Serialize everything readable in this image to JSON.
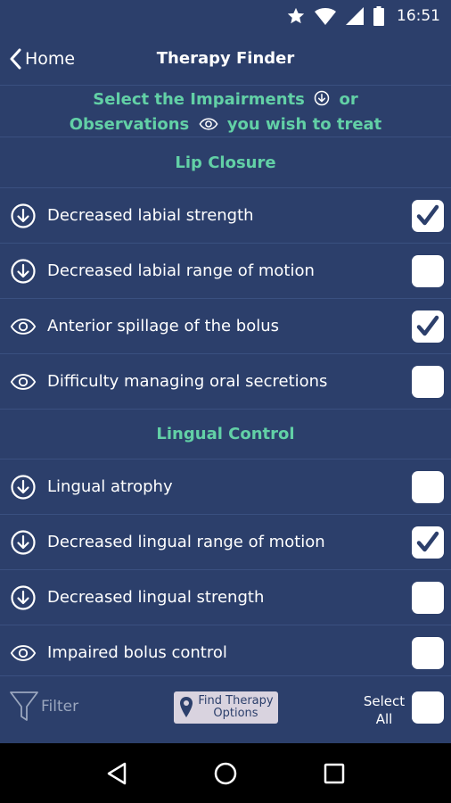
{
  "status": {
    "time": "16:51"
  },
  "header": {
    "back_label": "Home",
    "title": "Therapy Finder"
  },
  "instruction": {
    "line1_a": "Select the Impairments",
    "line1_b": "or",
    "line2_a": "Observations",
    "line2_b": "you wish to treat"
  },
  "sections": [
    {
      "title": "Lip Closure",
      "items": [
        {
          "type": "impairment",
          "label": "Decreased labial strength",
          "checked": true
        },
        {
          "type": "impairment",
          "label": "Decreased labial range of motion",
          "checked": false
        },
        {
          "type": "observation",
          "label": "Anterior spillage of the bolus",
          "checked": true
        },
        {
          "type": "observation",
          "label": "Difficulty managing oral secretions",
          "checked": false
        }
      ]
    },
    {
      "title": "Lingual Control",
      "items": [
        {
          "type": "impairment",
          "label": "Lingual atrophy",
          "checked": false
        },
        {
          "type": "impairment",
          "label": "Decreased lingual range of motion",
          "checked": true
        },
        {
          "type": "impairment",
          "label": "Decreased lingual strength",
          "checked": false
        },
        {
          "type": "observation",
          "label": "Impaired bolus control",
          "checked": false
        }
      ]
    }
  ],
  "bottom": {
    "filter_label": "Filter",
    "find_line1": "Find Therapy",
    "find_line2": "Options",
    "select_all_line1": "Select",
    "select_all_line2": "All",
    "select_all_checked": false
  },
  "colors": {
    "background": "#2c3f6b",
    "accent": "#62d0a6",
    "check": "#2c3f6b"
  }
}
